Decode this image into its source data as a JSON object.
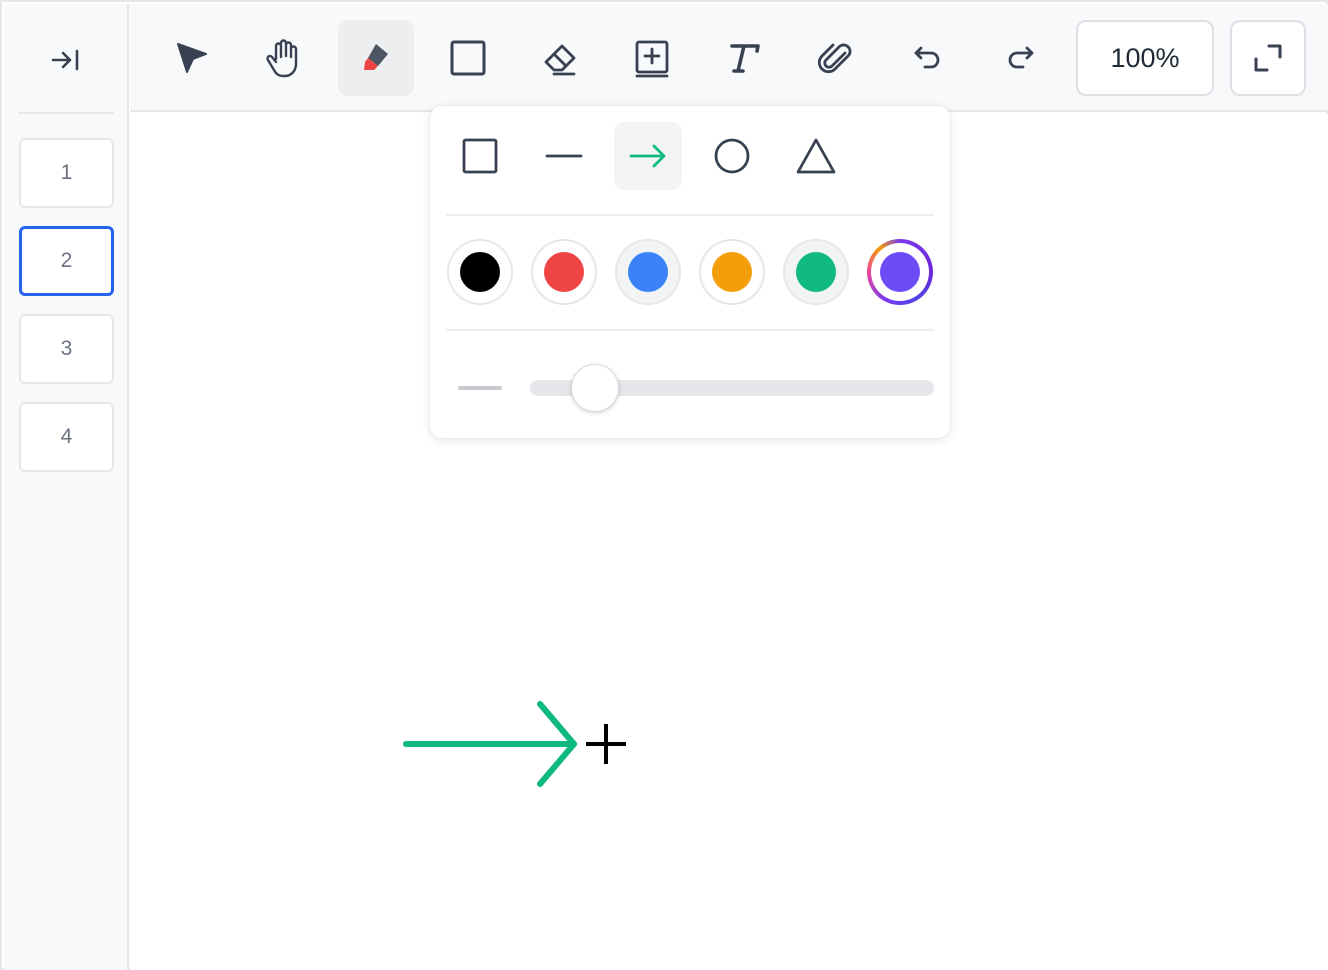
{
  "sidebar": {
    "toggle_icon": "collapse-sidebar-icon",
    "pages": [
      {
        "label": "1",
        "active": false
      },
      {
        "label": "2",
        "active": true
      },
      {
        "label": "3",
        "active": false
      },
      {
        "label": "4",
        "active": false
      }
    ]
  },
  "toolbar": {
    "tools": [
      {
        "name": "select",
        "icon": "cursor-arrow-icon",
        "active": false
      },
      {
        "name": "hand",
        "icon": "hand-icon",
        "active": false
      },
      {
        "name": "pen",
        "icon": "marker-icon",
        "active": true
      },
      {
        "name": "rectangle",
        "icon": "square-icon",
        "active": false
      },
      {
        "name": "eraser",
        "icon": "eraser-icon",
        "active": false
      },
      {
        "name": "add-frame",
        "icon": "add-box-icon",
        "active": false
      },
      {
        "name": "text",
        "icon": "text-icon",
        "active": false
      },
      {
        "name": "attach",
        "icon": "paperclip-icon",
        "active": false
      },
      {
        "name": "undo",
        "icon": "undo-icon",
        "active": false
      },
      {
        "name": "redo",
        "icon": "redo-icon",
        "active": false
      }
    ],
    "zoom_label": "100%",
    "fullscreen_icon": "expand-icon"
  },
  "shape_panel": {
    "shapes": [
      {
        "name": "rectangle",
        "icon": "square-outline-icon",
        "active": false
      },
      {
        "name": "line",
        "icon": "line-icon",
        "active": false
      },
      {
        "name": "arrow",
        "icon": "arrow-right-icon",
        "active": true
      },
      {
        "name": "ellipse",
        "icon": "circle-outline-icon",
        "active": false
      },
      {
        "name": "triangle",
        "icon": "triangle-outline-icon",
        "active": false
      }
    ],
    "colors": [
      {
        "name": "black",
        "hex": "#000000",
        "selected": false
      },
      {
        "name": "red",
        "hex": "#ef4444",
        "selected": false
      },
      {
        "name": "blue",
        "hex": "#3b82f6",
        "selected": false
      },
      {
        "name": "orange",
        "hex": "#f59e0b",
        "selected": false
      },
      {
        "name": "green",
        "hex": "#10b981",
        "selected": false
      },
      {
        "name": "violet",
        "hex": "#6d4cf7",
        "selected": true
      }
    ],
    "stroke_width_level": 0.16
  },
  "canvas": {
    "drawn_arrow_color": "#10b981",
    "cursor": "crosshair-icon"
  },
  "colors": {
    "accent": "#2563eb",
    "icon": "#374151",
    "arrow_active": "#10b981",
    "marker_tip": "#ef4444"
  }
}
